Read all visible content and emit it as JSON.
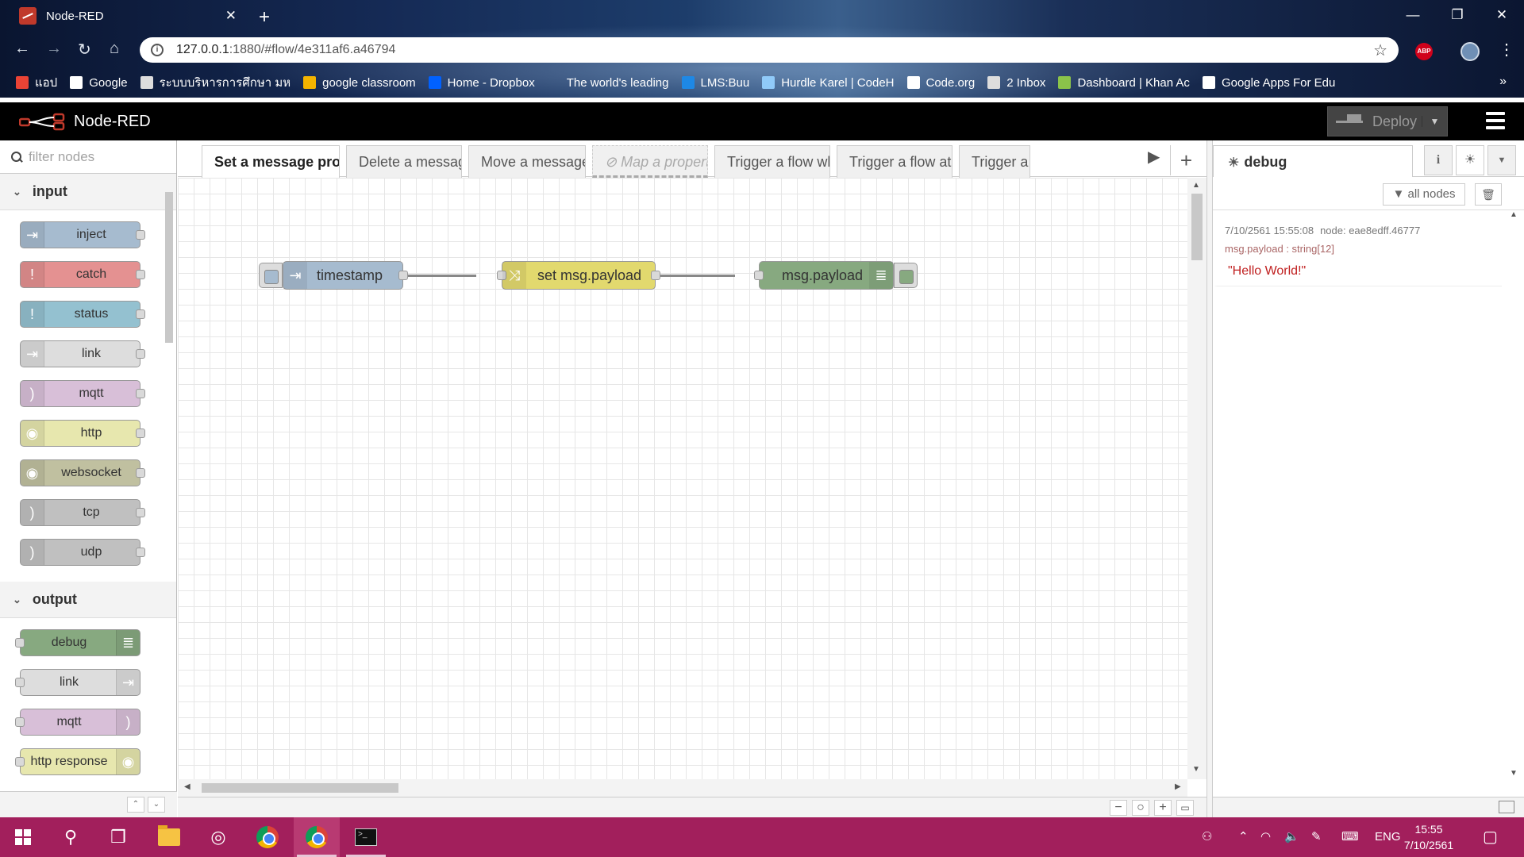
{
  "browser": {
    "tab_title": "Node-RED",
    "tab_close": "✕",
    "new_tab": "+",
    "window_controls": [
      "—",
      "❐",
      "✕"
    ],
    "url_host": "127.0.0.1",
    "url_path": ":1880/#flow/4e311af6.a46794",
    "bookmarks": [
      {
        "label": "แอป",
        "icon": "apps-icon",
        "color": "#ea4335"
      },
      {
        "label": "Google",
        "icon": "google-icon",
        "color": "#ffffff"
      },
      {
        "label": "ระบบบริหารการศึกษา มห",
        "icon": "page-icon",
        "color": "#dddddd"
      },
      {
        "label": "google classroom",
        "icon": "classroom-icon",
        "color": "#f4b400"
      },
      {
        "label": "Home - Dropbox",
        "icon": "dropbox-icon",
        "color": "#0061ff"
      },
      {
        "label": "The world's leading",
        "icon": "blank-icon",
        "color": "transparent"
      },
      {
        "label": "LMS:Buu",
        "icon": "lms-icon",
        "color": "#1e88e5"
      },
      {
        "label": "Hurdle Karel | CodeH",
        "icon": "codehs-icon",
        "color": "#90caf9"
      },
      {
        "label": "Code.org",
        "icon": "codeorg-icon",
        "color": "#ffffff"
      },
      {
        "label": "2 Inbox",
        "icon": "page-icon",
        "color": "#dddddd"
      },
      {
        "label": "Dashboard | Khan Ac",
        "icon": "khan-icon",
        "color": "#8bc34a"
      },
      {
        "label": "Google Apps For Edu",
        "icon": "blogger-icon",
        "color": "#ffffff"
      }
    ],
    "bookmarks_more": "»",
    "abp_label": "ABP"
  },
  "header": {
    "title": "Node-RED",
    "deploy_label": "Deploy"
  },
  "palette": {
    "search_placeholder": "filter nodes",
    "categories": [
      {
        "name": "input",
        "nodes": [
          {
            "label": "inject",
            "color": "#a6bbcf",
            "icon": "⇥"
          },
          {
            "label": "catch",
            "color": "#e49191",
            "icon": "!"
          },
          {
            "label": "status",
            "color": "#94c1d0",
            "icon": "!"
          },
          {
            "label": "link",
            "color": "#dddddd",
            "icon": "⇥"
          },
          {
            "label": "mqtt",
            "color": "#d8bfd8",
            "icon": ")"
          },
          {
            "label": "http",
            "color": "#e7e7ae",
            "icon": "◉"
          },
          {
            "label": "websocket",
            "color": "#c0c0a0",
            "icon": "◉"
          },
          {
            "label": "tcp",
            "color": "#c0c0c0",
            "icon": ")"
          },
          {
            "label": "udp",
            "color": "#c0c0c0",
            "icon": ")"
          }
        ]
      },
      {
        "name": "output",
        "nodes": [
          {
            "label": "debug",
            "color": "#87a980",
            "icon": "≣"
          },
          {
            "label": "link",
            "color": "#dddddd",
            "icon": "⇥"
          },
          {
            "label": "mqtt",
            "color": "#d8bfd8",
            "icon": ")"
          },
          {
            "label": "http response",
            "color": "#e7e7ae",
            "icon": "◉"
          }
        ]
      }
    ]
  },
  "workspace": {
    "tabs": [
      {
        "label": "Set a message property to a fixed value",
        "active": true,
        "disabled": false
      },
      {
        "label": "Delete a message property",
        "active": false,
        "disabled": false
      },
      {
        "label": "Move a message property",
        "active": false,
        "disabled": false
      },
      {
        "label": "Map a property between different numeric ranges",
        "active": false,
        "disabled": true
      },
      {
        "label": "Trigger a flow whenever Node-RED starts",
        "active": false,
        "disabled": false
      },
      {
        "label": "Trigger a flow at regular intervals",
        "active": false,
        "disabled": false
      },
      {
        "label": "Trigger a flow at a specific time",
        "active": false,
        "disabled": false
      }
    ],
    "flow_nodes": [
      {
        "label": "timestamp",
        "type": "inject",
        "color": "#a6bbcf"
      },
      {
        "label": "set msg.payload",
        "type": "change",
        "color": "#e2d96e"
      },
      {
        "label": "msg.payload",
        "type": "debug",
        "color": "#87a980"
      }
    ]
  },
  "sidebar": {
    "tab_label": "debug",
    "filter_label": "all nodes",
    "message": {
      "timestamp": "7/10/2561 15:55:08",
      "node": "node: eae8edff.46777",
      "property": "msg.payload : string[12]",
      "value": "\"Hello World!\""
    }
  },
  "taskbar": {
    "language": "ENG",
    "time": "15:55",
    "date": "7/10/2561"
  }
}
